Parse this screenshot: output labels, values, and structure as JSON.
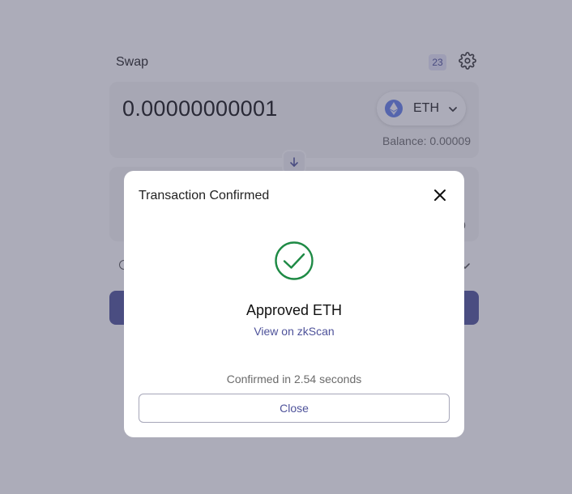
{
  "swap": {
    "title": "Swap",
    "badge": "23",
    "input": {
      "amount": "0.00000000001",
      "token": "ETH",
      "balance": "Balance: 0.00009"
    },
    "output": {
      "right_value_partial": "0"
    }
  },
  "modal": {
    "title": "Transaction Confirmed",
    "status_text": "Approved ETH",
    "link_text": "View on zkScan",
    "confirmed_text": "Confirmed in 2.54 seconds",
    "close_label": "Close"
  },
  "colors": {
    "accent": "#4e529a",
    "success": "#1e8a45",
    "eth": "#627eea",
    "overlay": "rgba(70,70,100,0.45)"
  },
  "icons": {
    "settings": "gear-icon",
    "swap_direction": "arrow-down-icon",
    "close": "close-icon",
    "success": "check-circle-icon",
    "token": "eth-icon",
    "dropdown": "chevron-down-icon"
  }
}
